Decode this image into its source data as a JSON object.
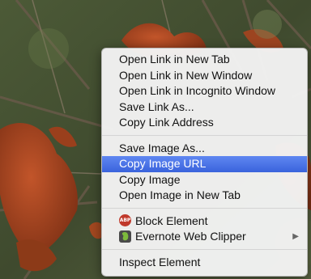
{
  "menu": {
    "group1": [
      {
        "label": "Open Link in New Tab"
      },
      {
        "label": "Open Link in New Window"
      },
      {
        "label": "Open Link in Incognito Window"
      },
      {
        "label": "Save Link As..."
      },
      {
        "label": "Copy Link Address"
      }
    ],
    "group2": [
      {
        "label": "Save Image As..."
      },
      {
        "label": "Copy Image URL",
        "highlighted": true
      },
      {
        "label": "Copy Image"
      },
      {
        "label": "Open Image in New Tab"
      }
    ],
    "group3": [
      {
        "label": "Block Element",
        "icon": "adblock-icon"
      },
      {
        "label": "Evernote Web Clipper",
        "icon": "evernote-icon",
        "submenu_arrow": "▶"
      }
    ],
    "group4": [
      {
        "label": "Inspect Element"
      }
    ]
  },
  "icons": {
    "adblock_text": "ABP"
  },
  "colors": {
    "highlight": "#4a72e6"
  },
  "background": {
    "description_icon": "autumn-oak-leaves-photo"
  }
}
